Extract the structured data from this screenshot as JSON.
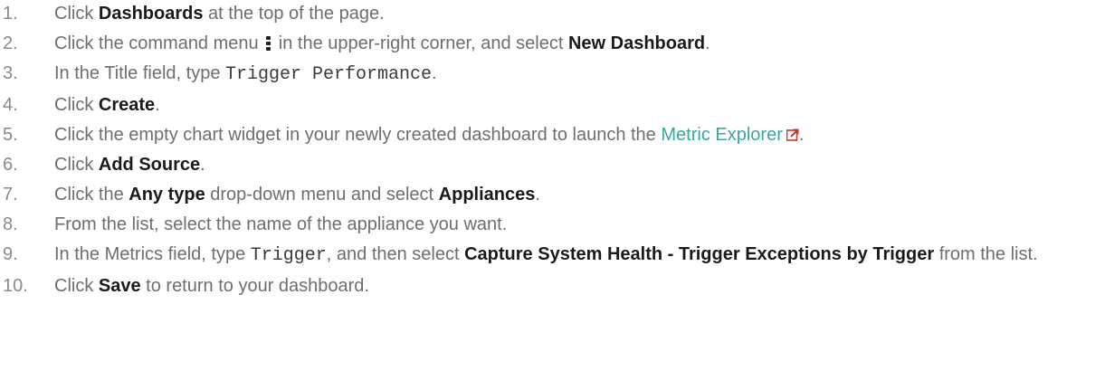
{
  "steps": [
    {
      "num": "1.",
      "parts": {
        "a": "Click ",
        "b": "Dashboards",
        "c": " at the top of the page."
      }
    },
    {
      "num": "2.",
      "parts": {
        "a": "Click the command menu ",
        "icon": "kebab-menu-icon",
        "b": " in the upper-right corner, and select ",
        "c": "New Dashboard",
        "d": "."
      }
    },
    {
      "num": "3.",
      "parts": {
        "a": "In the Title field, type ",
        "code": "Trigger Performance",
        "b": "."
      }
    },
    {
      "num": "4.",
      "parts": {
        "a": "Click ",
        "b": "Create",
        "c": "."
      }
    },
    {
      "num": "5.",
      "parts": {
        "a": "Click the empty chart widget in your newly created dashboard to launch the ",
        "link": "Metric Explorer",
        "icon": "external-link-icon",
        "b": "."
      }
    },
    {
      "num": "6.",
      "parts": {
        "a": "Click ",
        "b": "Add Source",
        "c": "."
      }
    },
    {
      "num": "7.",
      "parts": {
        "a": "Click the ",
        "b": "Any type",
        "c": " drop-down menu and select ",
        "d": "Appliances",
        "e": "."
      }
    },
    {
      "num": "8.",
      "parts": {
        "a": "From the list, select the name of the appliance you want."
      }
    },
    {
      "num": "9.",
      "parts": {
        "a": "In the Metrics field, type ",
        "code": "Trigger",
        "b": ", and then select ",
        "c": "Capture System Health - Trigger Exceptions by Trigger",
        "d": " from the list."
      }
    },
    {
      "num": "10.",
      "parts": {
        "a": "Click ",
        "b": "Save",
        "c": " to return to your dashboard."
      }
    }
  ],
  "colors": {
    "text": "#6e6e6e",
    "bold": "#1a1a1a",
    "link": "#3aa7a0"
  }
}
